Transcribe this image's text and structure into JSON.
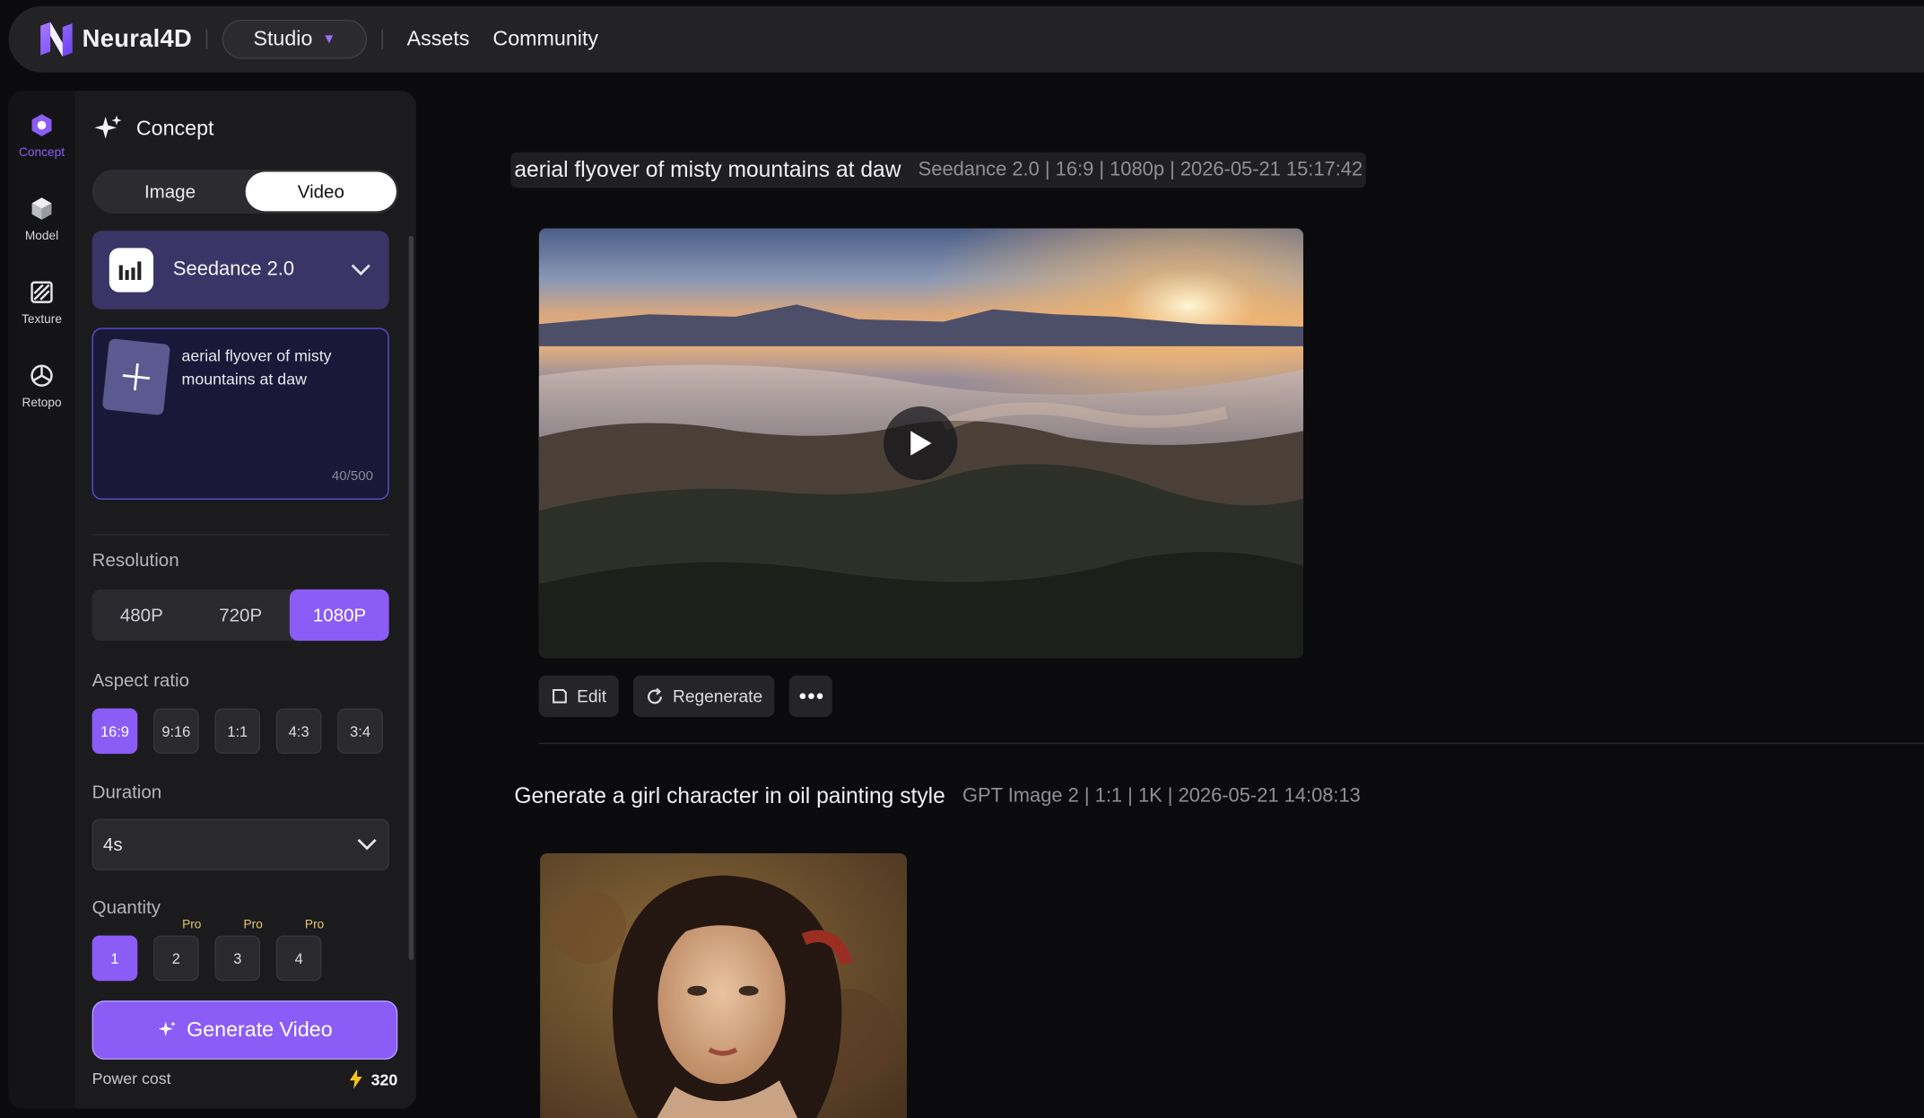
{
  "brand": {
    "name": "Neural4D"
  },
  "topbar": {
    "studio_label": "Studio",
    "nav": [
      "Assets",
      "Community"
    ]
  },
  "rail": [
    {
      "label": "Concept",
      "icon": "concept-icon",
      "active": true
    },
    {
      "label": "Model",
      "icon": "cube-icon",
      "active": false
    },
    {
      "label": "Texture",
      "icon": "texture-icon",
      "active": false
    },
    {
      "label": "Retopo",
      "icon": "retopo-icon",
      "active": false
    }
  ],
  "panel": {
    "title": "Concept",
    "mode_tabs": [
      "Image",
      "Video"
    ],
    "active_mode": "Video",
    "model": "Seedance 2.0",
    "prompt": "aerial flyover of misty mountains at daw",
    "prompt_count": "40/500",
    "resolution_label": "Resolution",
    "resolutions": [
      "480P",
      "720P",
      "1080P"
    ],
    "active_resolution": "1080P",
    "aspect_label": "Aspect ratio",
    "aspects": [
      "16:9",
      "9:16",
      "1:1",
      "4:3",
      "3:4"
    ],
    "active_aspect": "16:9",
    "duration_label": "Duration",
    "duration_value": "4s",
    "quantity_label": "Quantity",
    "quantities": [
      "1",
      "2",
      "3",
      "4"
    ],
    "pro_tag": "Pro",
    "active_quantity": "1",
    "generate_label": "Generate Video",
    "power_label": "Power cost",
    "power_value": "320"
  },
  "feed": {
    "entries": [
      {
        "prompt": "aerial flyover of misty mountains at daw",
        "meta": "Seedance 2.0 | 16:9 | 1080p | 2026-05-21 15:17:42"
      },
      {
        "prompt": "Generate a girl character in oil painting style",
        "meta": "GPT Image 2 | 1:1 | 1K | 2026-05-21 14:08:13"
      }
    ],
    "actions": {
      "edit": "Edit",
      "regenerate": "Regenerate"
    }
  },
  "colors": {
    "accent": "#8b5cf6",
    "panel": "#1b1b1e",
    "background": "#0b0b0d"
  }
}
